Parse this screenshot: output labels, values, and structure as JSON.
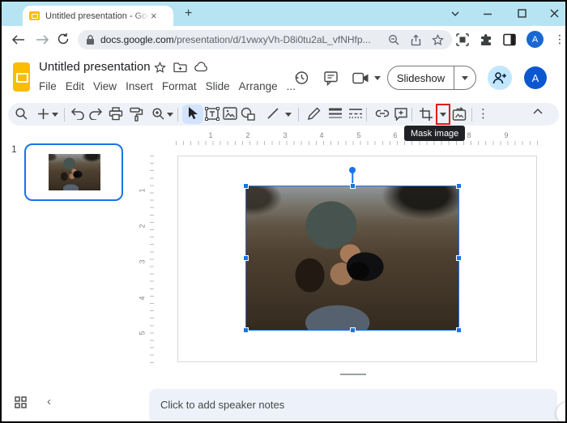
{
  "browser": {
    "tab_title": "Untitled presentation - Google Sl",
    "tab_close": "×",
    "new_tab": "+",
    "url_host": "docs.google.com",
    "url_path": "/presentation/d/1vwxyVh-D8i0tu2aL_vfNHfp...",
    "profile_initial": "A",
    "more_menu": "⋮"
  },
  "header": {
    "doc_title": "Untitled presentation",
    "menus": [
      "File",
      "Edit",
      "View",
      "Insert",
      "Format",
      "Slide",
      "Arrange",
      "..."
    ],
    "slideshow_label": "Slideshow",
    "profile_initial": "A"
  },
  "toolbar": {
    "mask_image_tooltip": "Mask image",
    "more_label": "⋮"
  },
  "filmstrip": {
    "slide_number": "1"
  },
  "rulers": {
    "horizontal": [
      "1",
      "2",
      "3",
      "4",
      "5",
      "6",
      "7",
      "8",
      "9"
    ],
    "vertical": [
      "1",
      "2",
      "3",
      "4",
      "5"
    ]
  },
  "slide": {
    "image_alt": "Person in a knit beanie holding a camera to their face in a blurred autumn field"
  },
  "notes": {
    "placeholder": "Click to add speaker notes"
  },
  "misc": {
    "edge_collapse": "‹",
    "left_collapse": "‹"
  },
  "colors": {
    "titlebar": "#b7e4f2",
    "accent_blue": "#1a73e8",
    "highlight_red": "#e01b1b",
    "tooltip_bg": "#202124",
    "notes_bg": "#edf2fa",
    "selected_tool_bg": "#d3e3fd",
    "slides_yellow": "#fbbc04",
    "avatar_blue": "#0b57d0",
    "share_circle_bg": "#c2e7ff"
  }
}
